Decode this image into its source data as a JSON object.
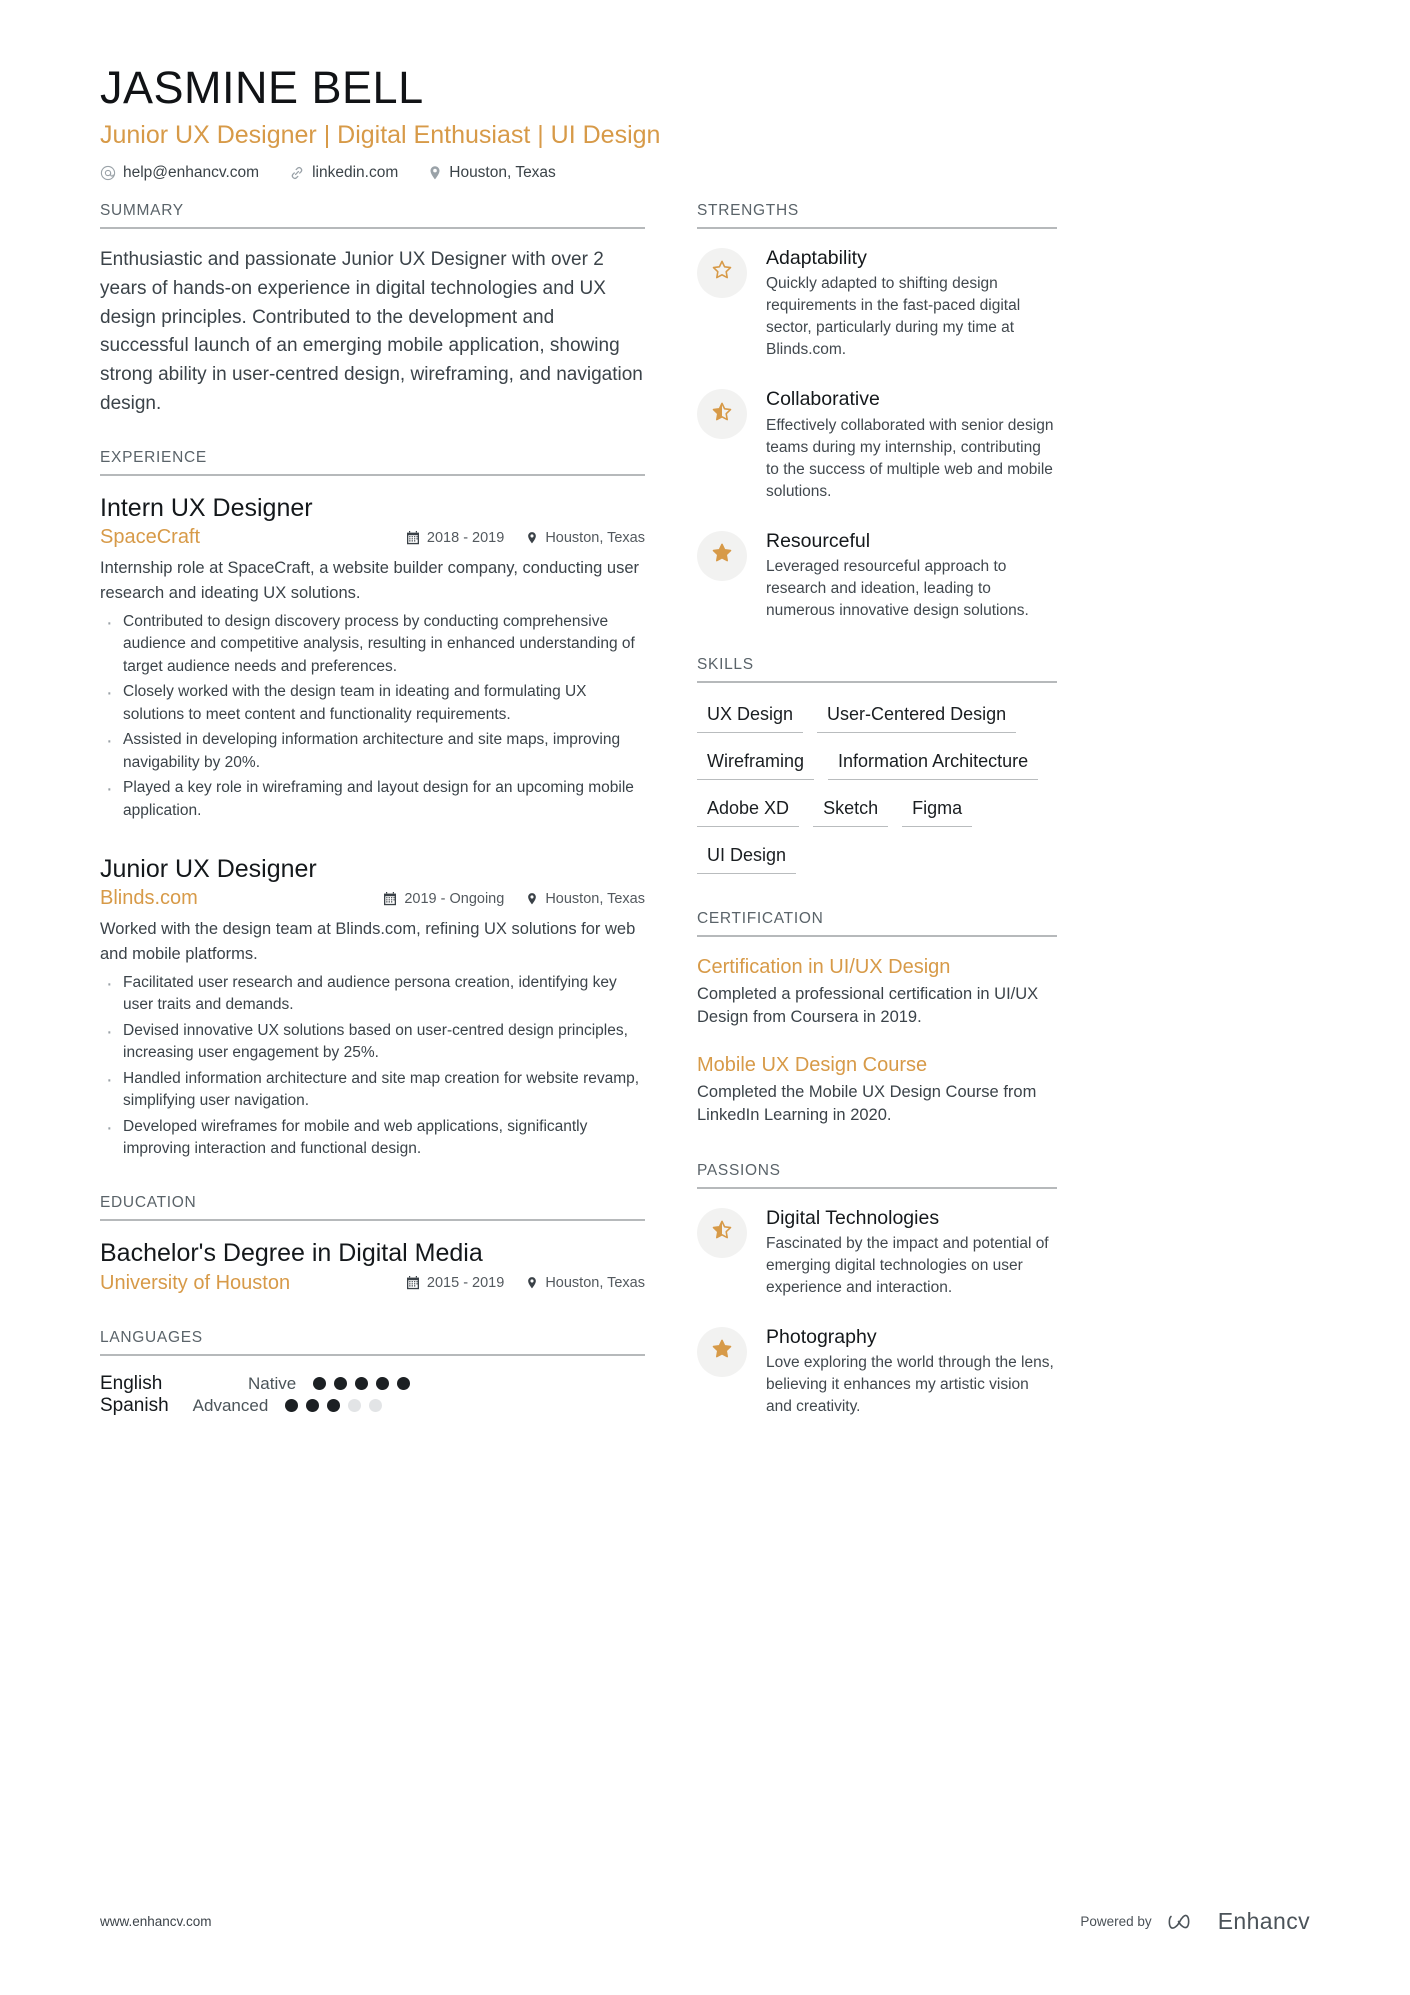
{
  "header": {
    "name": "JASMINE BELL",
    "headline": "Junior UX Designer | Digital Enthusiast | UI Design",
    "contacts": [
      {
        "icon": "at-icon",
        "text": "help@enhancv.com"
      },
      {
        "icon": "link-icon",
        "text": "linkedin.com"
      },
      {
        "icon": "location-pin-icon",
        "text": "Houston, Texas"
      }
    ]
  },
  "accent_color": "#d79a48",
  "left": {
    "summary": {
      "title": "SUMMARY",
      "text": "Enthusiastic and passionate Junior UX Designer with over 2 years of hands-on experience in digital technologies and UX design principles. Contributed to the development and successful launch of an emerging mobile application, showing strong ability in user-centred design, wireframing, and navigation design."
    },
    "experience": {
      "title": "EXPERIENCE",
      "entries": [
        {
          "title": "Intern UX Designer",
          "org": "SpaceCraft",
          "dates": "2018 - 2019",
          "location": "Houston, Texas",
          "desc": "Internship role at SpaceCraft, a website builder company, conducting user research and ideating UX solutions.",
          "bullets": [
            "Contributed to design discovery process by conducting comprehensive audience and competitive analysis, resulting in enhanced understanding of target audience needs and preferences.",
            "Closely worked with the design team in ideating and formulating UX solutions to meet content and functionality requirements.",
            "Assisted in developing information architecture and site maps, improving navigability by 20%.",
            "Played a key role in wireframing and layout design for an upcoming mobile application."
          ]
        },
        {
          "title": "Junior UX Designer",
          "org": "Blinds.com",
          "dates": "2019 - Ongoing",
          "location": "Houston, Texas",
          "desc": "Worked with the design team at Blinds.com, refining UX solutions for web and mobile platforms.",
          "bullets": [
            "Facilitated user research and audience persona creation, identifying key user traits and demands.",
            "Devised innovative UX solutions based on user-centred design principles, increasing user engagement by 25%.",
            "Handled information architecture and site map creation for website revamp, simplifying user navigation.",
            "Developed wireframes for mobile and web applications, significantly improving interaction and functional design."
          ]
        }
      ]
    },
    "education": {
      "title": "EDUCATION",
      "entries": [
        {
          "title": "Bachelor's Degree in Digital Media",
          "org": "University of Houston",
          "dates": "2015 - 2019",
          "location": "Houston, Texas"
        }
      ]
    },
    "languages": {
      "title": "LANGUAGES",
      "items": [
        {
          "name": "English",
          "level": "Native",
          "filled": 5,
          "total": 5
        },
        {
          "name": "Spanish",
          "level": "Advanced",
          "filled": 3,
          "total": 5
        }
      ]
    }
  },
  "right": {
    "strengths": {
      "title": "STRENGTHS",
      "items": [
        {
          "icon": "star-outline-icon",
          "title": "Adaptability",
          "desc": "Quickly adapted to shifting design requirements in the fast-paced digital sector, particularly during my time at Blinds.com."
        },
        {
          "icon": "star-half-icon",
          "title": "Collaborative",
          "desc": "Effectively collaborated with senior design teams during my internship, contributing to the success of multiple web and mobile solutions."
        },
        {
          "icon": "star-filled-icon",
          "title": "Resourceful",
          "desc": "Leveraged resourceful approach to research and ideation, leading to numerous innovative design solutions."
        }
      ]
    },
    "skills": {
      "title": "SKILLS",
      "items": [
        "UX Design",
        "User-Centered Design",
        "Wireframing",
        "Information Architecture",
        "Adobe XD",
        "Sketch",
        "Figma",
        "UI Design"
      ]
    },
    "certification": {
      "title": "CERTIFICATION",
      "items": [
        {
          "title": "Certification in UI/UX Design",
          "desc": "Completed a professional certification in UI/UX Design from Coursera in 2019."
        },
        {
          "title": "Mobile UX Design Course",
          "desc": "Completed the Mobile UX Design Course from LinkedIn Learning in 2020."
        }
      ]
    },
    "passions": {
      "title": "PASSIONS",
      "items": [
        {
          "icon": "star-half-icon",
          "title": "Digital Technologies",
          "desc": "Fascinated by the impact and potential of emerging digital technologies on user experience and interaction."
        },
        {
          "icon": "star-filled-icon",
          "title": "Photography",
          "desc": "Love exploring the world through the lens, believing it enhances my artistic vision and creativity."
        }
      ]
    }
  },
  "footer": {
    "url": "www.enhancv.com",
    "powered_by": "Powered by",
    "brand": "Enhancv"
  }
}
